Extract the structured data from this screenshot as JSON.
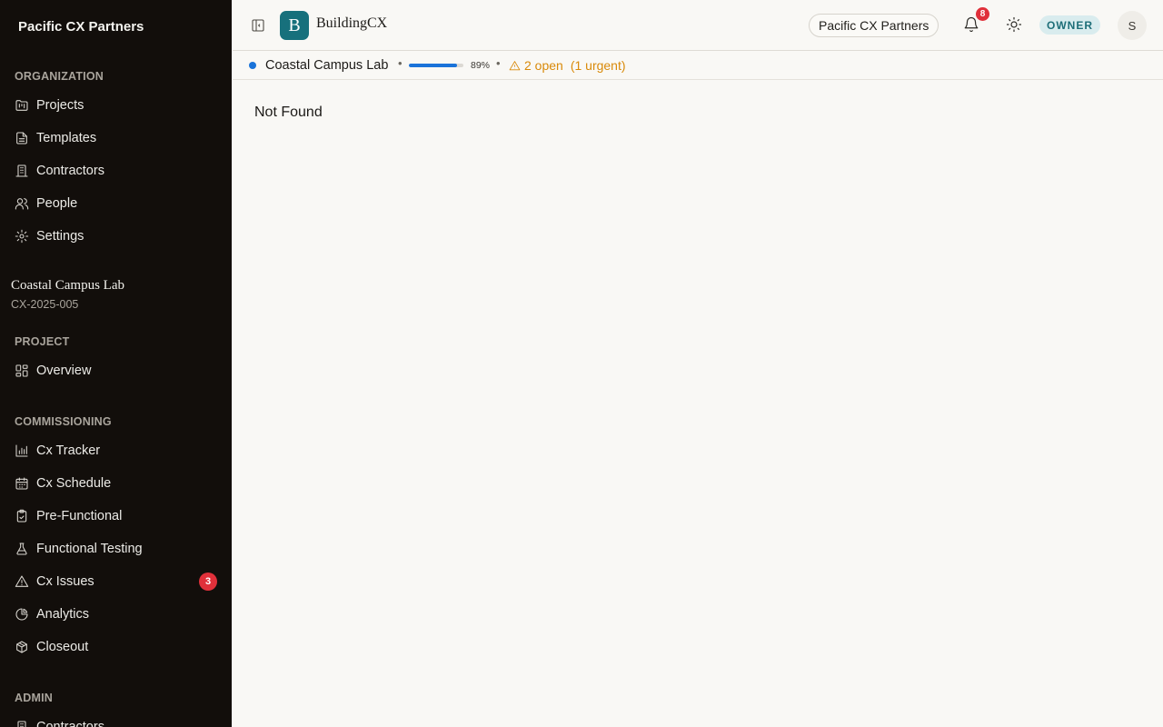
{
  "sidebar": {
    "org_name": "Pacific CX Partners",
    "organization_label": "ORGANIZATION",
    "organization_items": [
      {
        "label": "Projects",
        "icon": "folder-kanban-icon"
      },
      {
        "label": "Templates",
        "icon": "file-text-icon"
      },
      {
        "label": "Contractors",
        "icon": "building-icon"
      },
      {
        "label": "People",
        "icon": "users-icon"
      },
      {
        "label": "Settings",
        "icon": "gear-icon"
      }
    ],
    "project": {
      "name": "Coastal Campus Lab",
      "code": "CX-2025-005"
    },
    "project_label": "PROJECT",
    "project_items": [
      {
        "label": "Overview",
        "icon": "layout-dashboard-icon"
      }
    ],
    "commissioning_label": "COMMISSIONING",
    "commissioning_items": [
      {
        "label": "Cx Tracker",
        "icon": "bar-chart-icon"
      },
      {
        "label": "Cx Schedule",
        "icon": "calendar-icon"
      },
      {
        "label": "Pre-Functional",
        "icon": "clipboard-check-icon"
      },
      {
        "label": "Functional Testing",
        "icon": "flask-icon"
      },
      {
        "label": "Cx Issues",
        "icon": "warning-triangle-icon",
        "badge": "3"
      },
      {
        "label": "Analytics",
        "icon": "pie-chart-icon"
      },
      {
        "label": "Closeout",
        "icon": "package-icon"
      }
    ],
    "admin_label": "ADMIN",
    "admin_items": [
      {
        "label": "Contractors",
        "icon": "building-icon"
      }
    ]
  },
  "topbar": {
    "logo_letter": "B",
    "brand": "BuildingCX",
    "org_pill": "Pacific CX Partners",
    "notification_count": "8",
    "role": "OWNER",
    "avatar_initial": "S"
  },
  "project_bar": {
    "name": "Coastal Campus Lab",
    "separator": "•",
    "progress": 0.89,
    "progress_label": "89%",
    "open_issues": "2 open",
    "urgent": "(1 urgent)"
  },
  "main": {
    "message": "Not Found"
  },
  "colors": {
    "sidebar_bg": "#120e0b",
    "accent_teal": "#17707c",
    "progress_blue": "#1a73d9",
    "warning_amber": "#d98a0a",
    "badge_red": "#e0303a"
  }
}
